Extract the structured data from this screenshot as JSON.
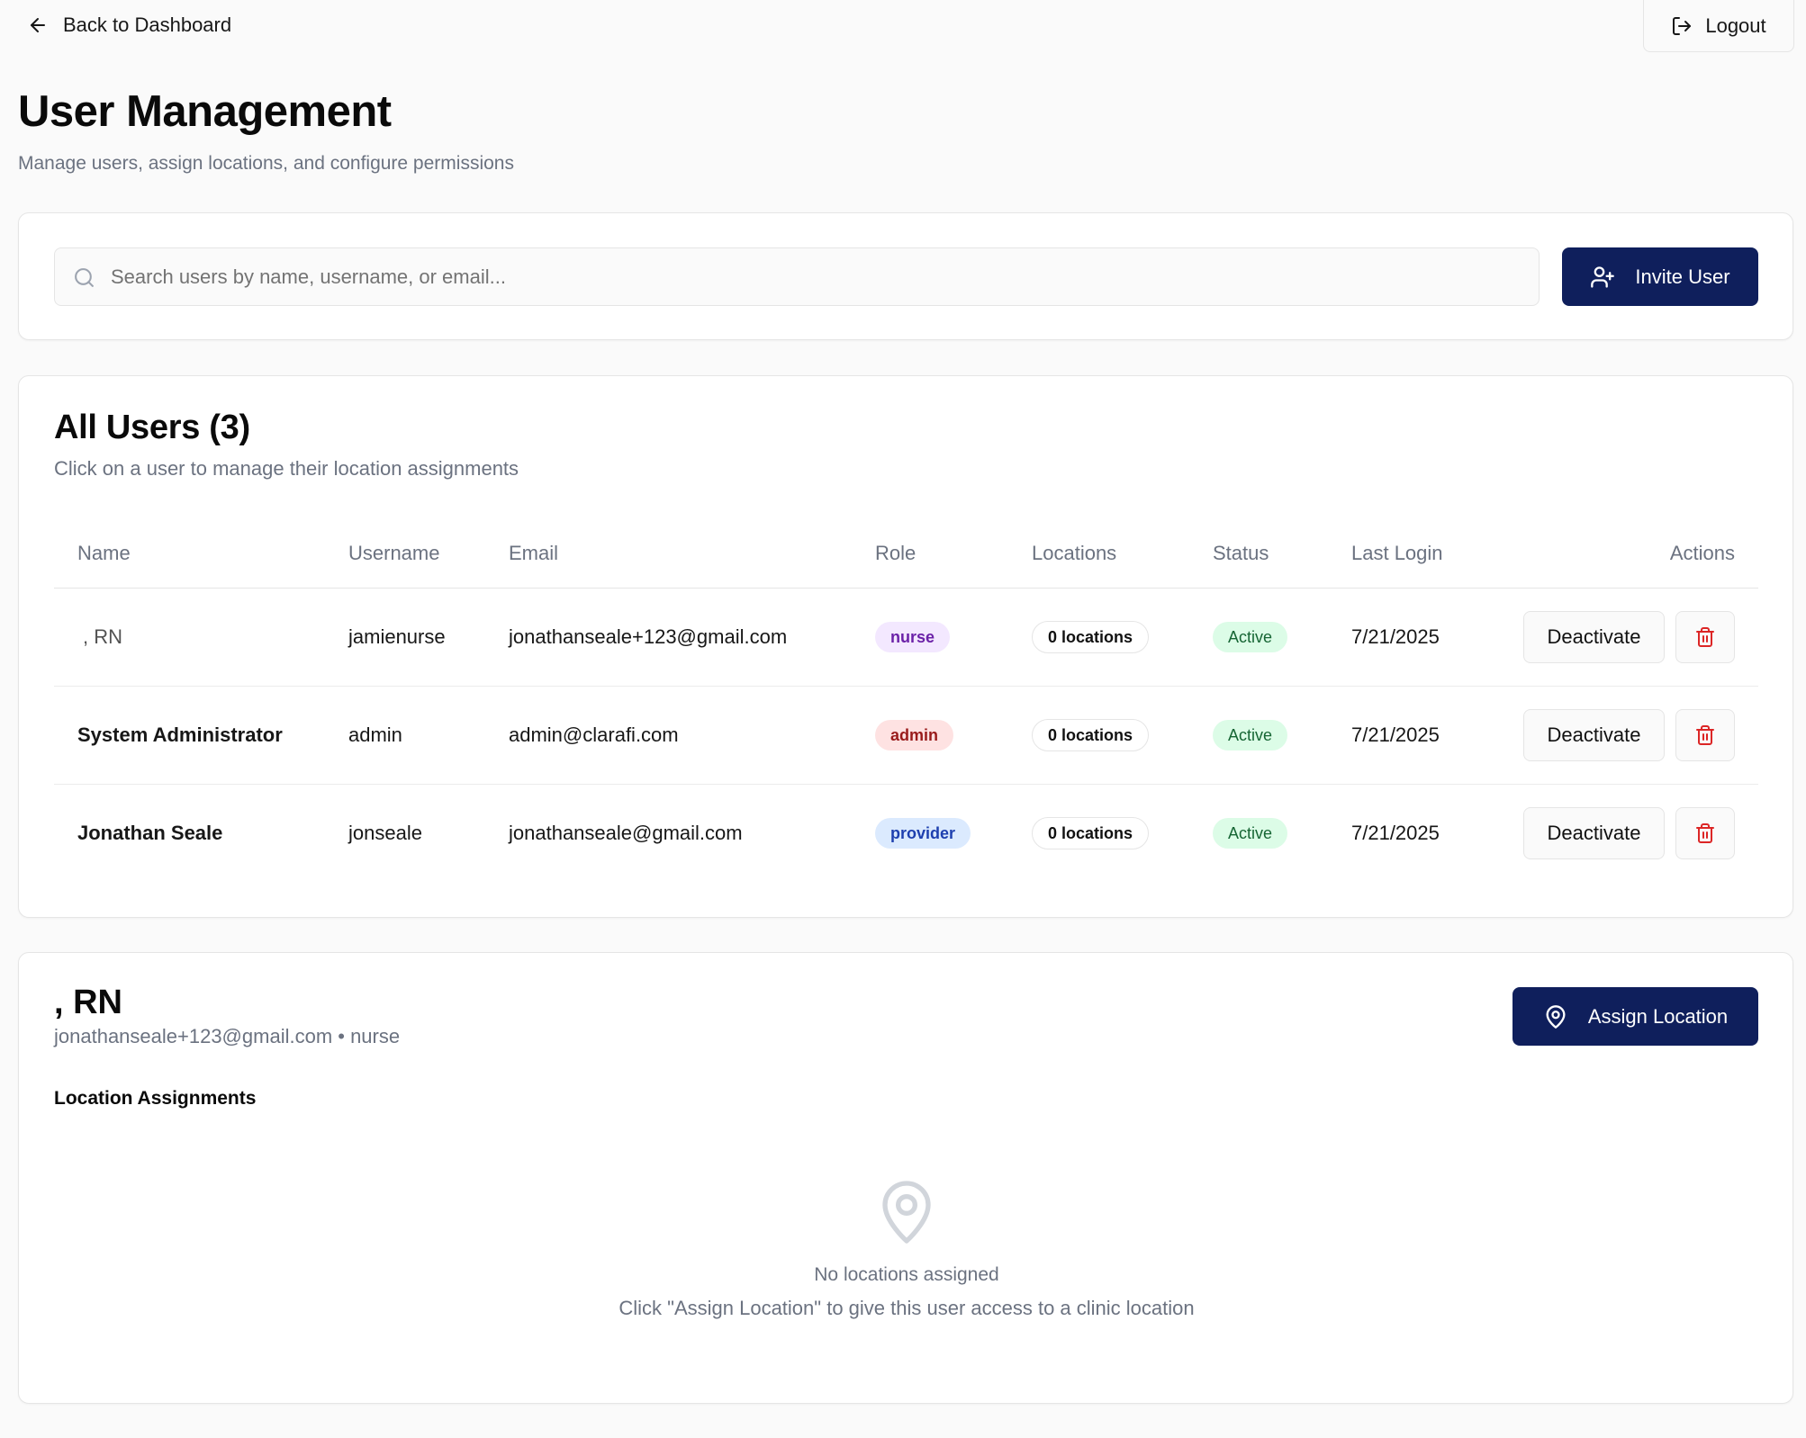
{
  "nav": {
    "back_label": "Back to Dashboard",
    "logout_label": "Logout"
  },
  "header": {
    "title": "User Management",
    "subtitle": "Manage users, assign locations, and configure permissions"
  },
  "search": {
    "placeholder": "Search users by name, username, or email...",
    "value": "",
    "invite_label": "Invite User"
  },
  "users_table": {
    "title": "All Users (3)",
    "description": "Click on a user to manage their location assignments",
    "columns": [
      "Name",
      "Username",
      "Email",
      "Role",
      "Locations",
      "Status",
      "Last Login",
      "Actions"
    ],
    "rows": [
      {
        "name": ", RN",
        "username": "jamienurse",
        "email": "jonathanseale+123@gmail.com",
        "role": "nurse",
        "locations": "0 locations",
        "status": "Active",
        "last_login": "7/21/2025",
        "action_label": "Deactivate"
      },
      {
        "name": "System Administrator",
        "username": "admin",
        "email": "admin@clarafi.com",
        "role": "admin",
        "locations": "0 locations",
        "status": "Active",
        "last_login": "7/21/2025",
        "action_label": "Deactivate"
      },
      {
        "name": "Jonathan Seale",
        "username": "jonseale",
        "email": "jonathanseale@gmail.com",
        "role": "provider",
        "locations": "0 locations",
        "status": "Active",
        "last_login": "7/21/2025",
        "action_label": "Deactivate"
      }
    ]
  },
  "selected_user": {
    "name": ", RN",
    "meta": "jonathanseale+123@gmail.com • nurse",
    "assign_label": "Assign Location",
    "assignments_heading": "Location Assignments",
    "empty_title": "No locations assigned",
    "empty_description": "Click \"Assign Location\" to give this user access to a clinic location"
  },
  "colors": {
    "primary": "#0f1f5c",
    "background": "#fafafa",
    "danger": "#dc2626",
    "success": "#166534"
  },
  "icons": [
    "arrow-left-icon",
    "logout-icon",
    "search-icon",
    "user-plus-icon",
    "trash-icon",
    "map-pin-icon"
  ]
}
